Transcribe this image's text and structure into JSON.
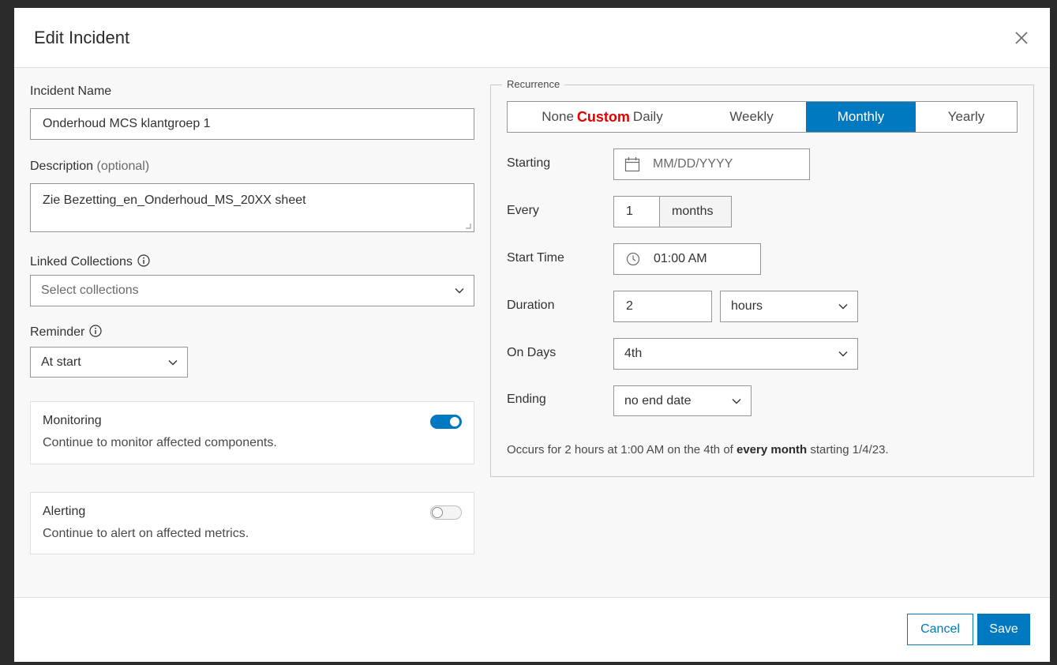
{
  "dialog": {
    "title": "Edit Incident",
    "close_icon": "close-icon"
  },
  "form": {
    "incident_name_label": "Incident Name",
    "incident_name_value": "Onderhoud MCS klantgroep 1",
    "description_label": "Description",
    "description_optional": "(optional)",
    "description_value": "Zie Bezetting_en_Onderhoud_MS_20XX sheet",
    "linked_collections_label": "Linked Collections",
    "linked_collections_placeholder": "Select collections",
    "reminder_label": "Reminder",
    "reminder_value": "At start",
    "monitoring": {
      "title": "Monitoring",
      "subtitle": "Continue to monitor affected components.",
      "enabled": true
    },
    "alerting": {
      "title": "Alerting",
      "subtitle": "Continue to alert on affected metrics.",
      "enabled": false
    }
  },
  "recurrence": {
    "legend": "Recurrence",
    "tabs": {
      "none": "None",
      "custom": "Custom",
      "daily": "Daily",
      "weekly": "Weekly",
      "monthly": "Monthly",
      "yearly": "Yearly"
    },
    "active_tab": "Monthly",
    "starting_label": "Starting",
    "starting_placeholder": "MM/DD/YYYY",
    "every_label": "Every",
    "every_value": "1",
    "every_unit": "months",
    "start_time_label": "Start Time",
    "start_time_value": "01:00 AM",
    "duration_label": "Duration",
    "duration_value": "2",
    "duration_unit": "hours",
    "on_days_label": "On Days",
    "on_days_value": "4th",
    "ending_label": "Ending",
    "ending_value": "no end date",
    "summary_pre": "Occurs for 2 hours at 1:00 AM on the 4th of",
    "summary_bold": "every month",
    "summary_post": "starting 1/4/23."
  },
  "footer": {
    "cancel_label": "Cancel",
    "save_label": "Save"
  },
  "colors": {
    "accent": "#0079c1",
    "custom_text": "#e00000"
  }
}
